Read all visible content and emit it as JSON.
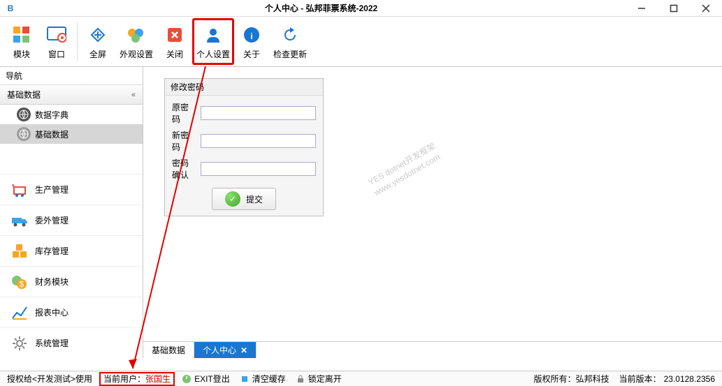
{
  "window": {
    "title": "个人中心 - 弘邦菲票系统-2022"
  },
  "toolbar": {
    "module": "模块",
    "window_btn": "窗口",
    "fullscreen": "全屏",
    "appearance": "外观设置",
    "close": "关闭",
    "profile": "个人设置",
    "about": "关于",
    "check_update": "检查更新"
  },
  "sidebar": {
    "header": "导航",
    "group": "基础数据",
    "dict": "数据字典",
    "base": "基础数据",
    "sections": {
      "prod": "生产管理",
      "outsource": "委外管理",
      "inventory": "库存管理",
      "finance": "财务模块",
      "report": "报表中心",
      "system": "系统管理"
    }
  },
  "panel": {
    "title": "修改密码",
    "old": "原密码",
    "new": "新密码",
    "confirm": "密码确认",
    "submit": "提交"
  },
  "watermark": {
    "line1": "YES dotnet开发框架",
    "line2": "www.yesdotnet.com"
  },
  "tabs": {
    "base": "基础数据",
    "profile": "个人中心"
  },
  "status": {
    "license": "授权给<开发测试>使用",
    "curuser_label": "当前用户：",
    "curuser_name": "张国生",
    "exit": "EXIT登出",
    "clear": "清空缓存",
    "lock": "锁定离开",
    "copyright": "版权所有：弘邦科技",
    "version_label": "当前版本：",
    "version": "23.0128.2356"
  }
}
